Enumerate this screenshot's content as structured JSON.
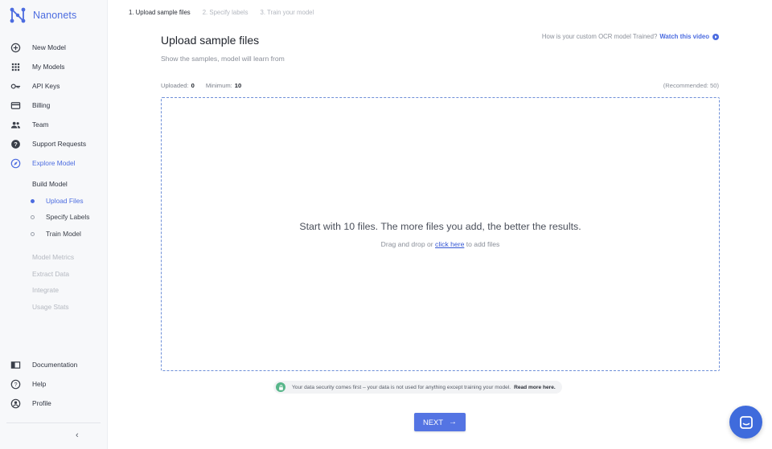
{
  "brand": {
    "name": "Nanonets"
  },
  "sidebar": {
    "items": [
      {
        "label": "New Model",
        "icon": "plus-circle-icon"
      },
      {
        "label": "My Models",
        "icon": "grid-icon"
      },
      {
        "label": "API Keys",
        "icon": "key-icon"
      },
      {
        "label": "Billing",
        "icon": "credit-card-icon"
      },
      {
        "label": "Team",
        "icon": "team-icon"
      },
      {
        "label": "Support Requests",
        "icon": "help-icon"
      },
      {
        "label": "Explore Model",
        "icon": "compass-icon",
        "active": true
      }
    ],
    "build_model": {
      "heading": "Build Model",
      "steps": [
        {
          "label": "Upload Files",
          "active": true
        },
        {
          "label": "Specify Labels"
        },
        {
          "label": "Train Model"
        }
      ]
    },
    "disabled_items": [
      "Model Metrics",
      "Extract Data",
      "Integrate",
      "Usage Stats"
    ],
    "bottom_items": [
      {
        "label": "Documentation",
        "icon": "book-icon"
      },
      {
        "label": "Help",
        "icon": "question-circle-icon"
      },
      {
        "label": "Profile",
        "icon": "user-circle-icon"
      }
    ],
    "collapse_icon": "‹"
  },
  "steps": [
    "1.  Upload sample files",
    "2.  Specify labels",
    "3.  Train your model"
  ],
  "main": {
    "title": "Upload sample files",
    "subtitle": "Show the samples, model will learn from",
    "video_hint": "How is your custom OCR model Trained?",
    "video_link": "Watch this video",
    "uploaded_label": "Uploaded:",
    "uploaded_value": "0",
    "minimum_label": "Minimum:",
    "minimum_value": "10",
    "recommended": "(Recommended: 50)",
    "drop_main": "Start with 10 files. The more files you add, the better the results.",
    "drop_sub_prefix": "Drag and drop or",
    "drop_sub_link": "click here",
    "drop_sub_suffix": "to add files",
    "security_text": "Your data security comes first – your data is not used for anything except training your model.",
    "security_link": "Read more here.",
    "next_label": "NEXT",
    "next_arrow": "→"
  },
  "colors": {
    "accent": "#4c6ce0",
    "button": "#5474e3",
    "secure": "#58b68a",
    "chat": "#3f6bdc"
  }
}
